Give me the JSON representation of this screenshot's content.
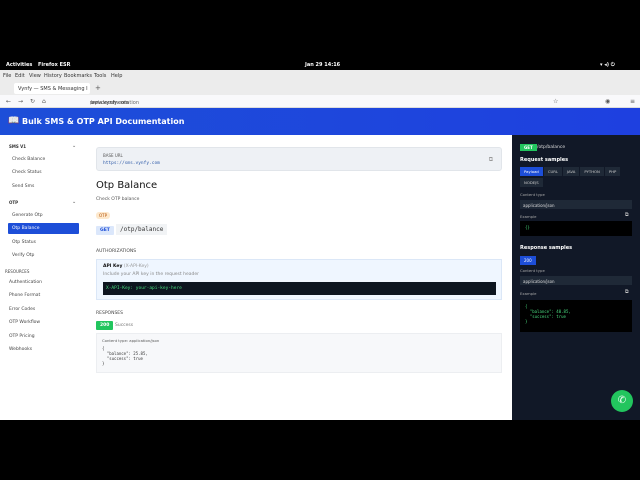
{
  "system": {
    "activities": "Activities",
    "app": "Firefox ESR",
    "clock": "Jan 29  14:16"
  },
  "browser": {
    "menu": [
      "File",
      "Edit",
      "View",
      "History",
      "Bookmarks",
      "Tools",
      "Help"
    ],
    "tab_title": "Vynfy — SMS & Messaging I",
    "url_domain": "www.vynfy.com",
    "url_path": "/api-documentation"
  },
  "header": {
    "title": "Bulk SMS & OTP API Documentation"
  },
  "sidebar": {
    "sms_section": "SMS V1",
    "sms_items": [
      "Check Balance",
      "Check Status",
      "Send Sms"
    ],
    "otp_section": "OTP",
    "otp_items": [
      "Generate Otp",
      "Otp Balance",
      "Otp Status",
      "Verify Otp"
    ],
    "resources_section": "RESOURCES",
    "resources_items": [
      "Authentication",
      "Phone Format",
      "Error Codes",
      "OTP Workflow",
      "OTP Pricing",
      "Webhooks"
    ]
  },
  "main": {
    "base_url_label": "BASE URL",
    "base_url": "https://sms.vynfy.com",
    "title": "Otp Balance",
    "description": "Check OTP balance",
    "tag": "OTP",
    "method": "GET",
    "path": "/otp/balance",
    "auth_label": "AUTHORIZATIONS",
    "auth_name": "API Key",
    "auth_header": "(X-API-Key)",
    "auth_desc": "Include your API key in the request header",
    "auth_example": "X-API-Key: your-api-key-here",
    "responses_label": "RESPONSES",
    "status_code": "200",
    "status_text": "Success",
    "content_type_line": "Content type: application/json",
    "response_body": "{\n  \"balance\": 25.85,\n  \"success\": true\n}"
  },
  "right_panel": {
    "method": "GET",
    "path": "/otp/balance",
    "request_samples": "Request samples",
    "langs": [
      "Payload",
      "CURL",
      "JAVA",
      "PYTHON",
      "PHP",
      "NODEJS"
    ],
    "content_type_label": "Content type",
    "content_type": "application/json",
    "example_label": "Example",
    "request_example": "{}",
    "response_samples": "Response samples",
    "status_code": "200",
    "response_example": "{\n  \"balance\": 40.85,\n  \"success\": true\n}"
  }
}
